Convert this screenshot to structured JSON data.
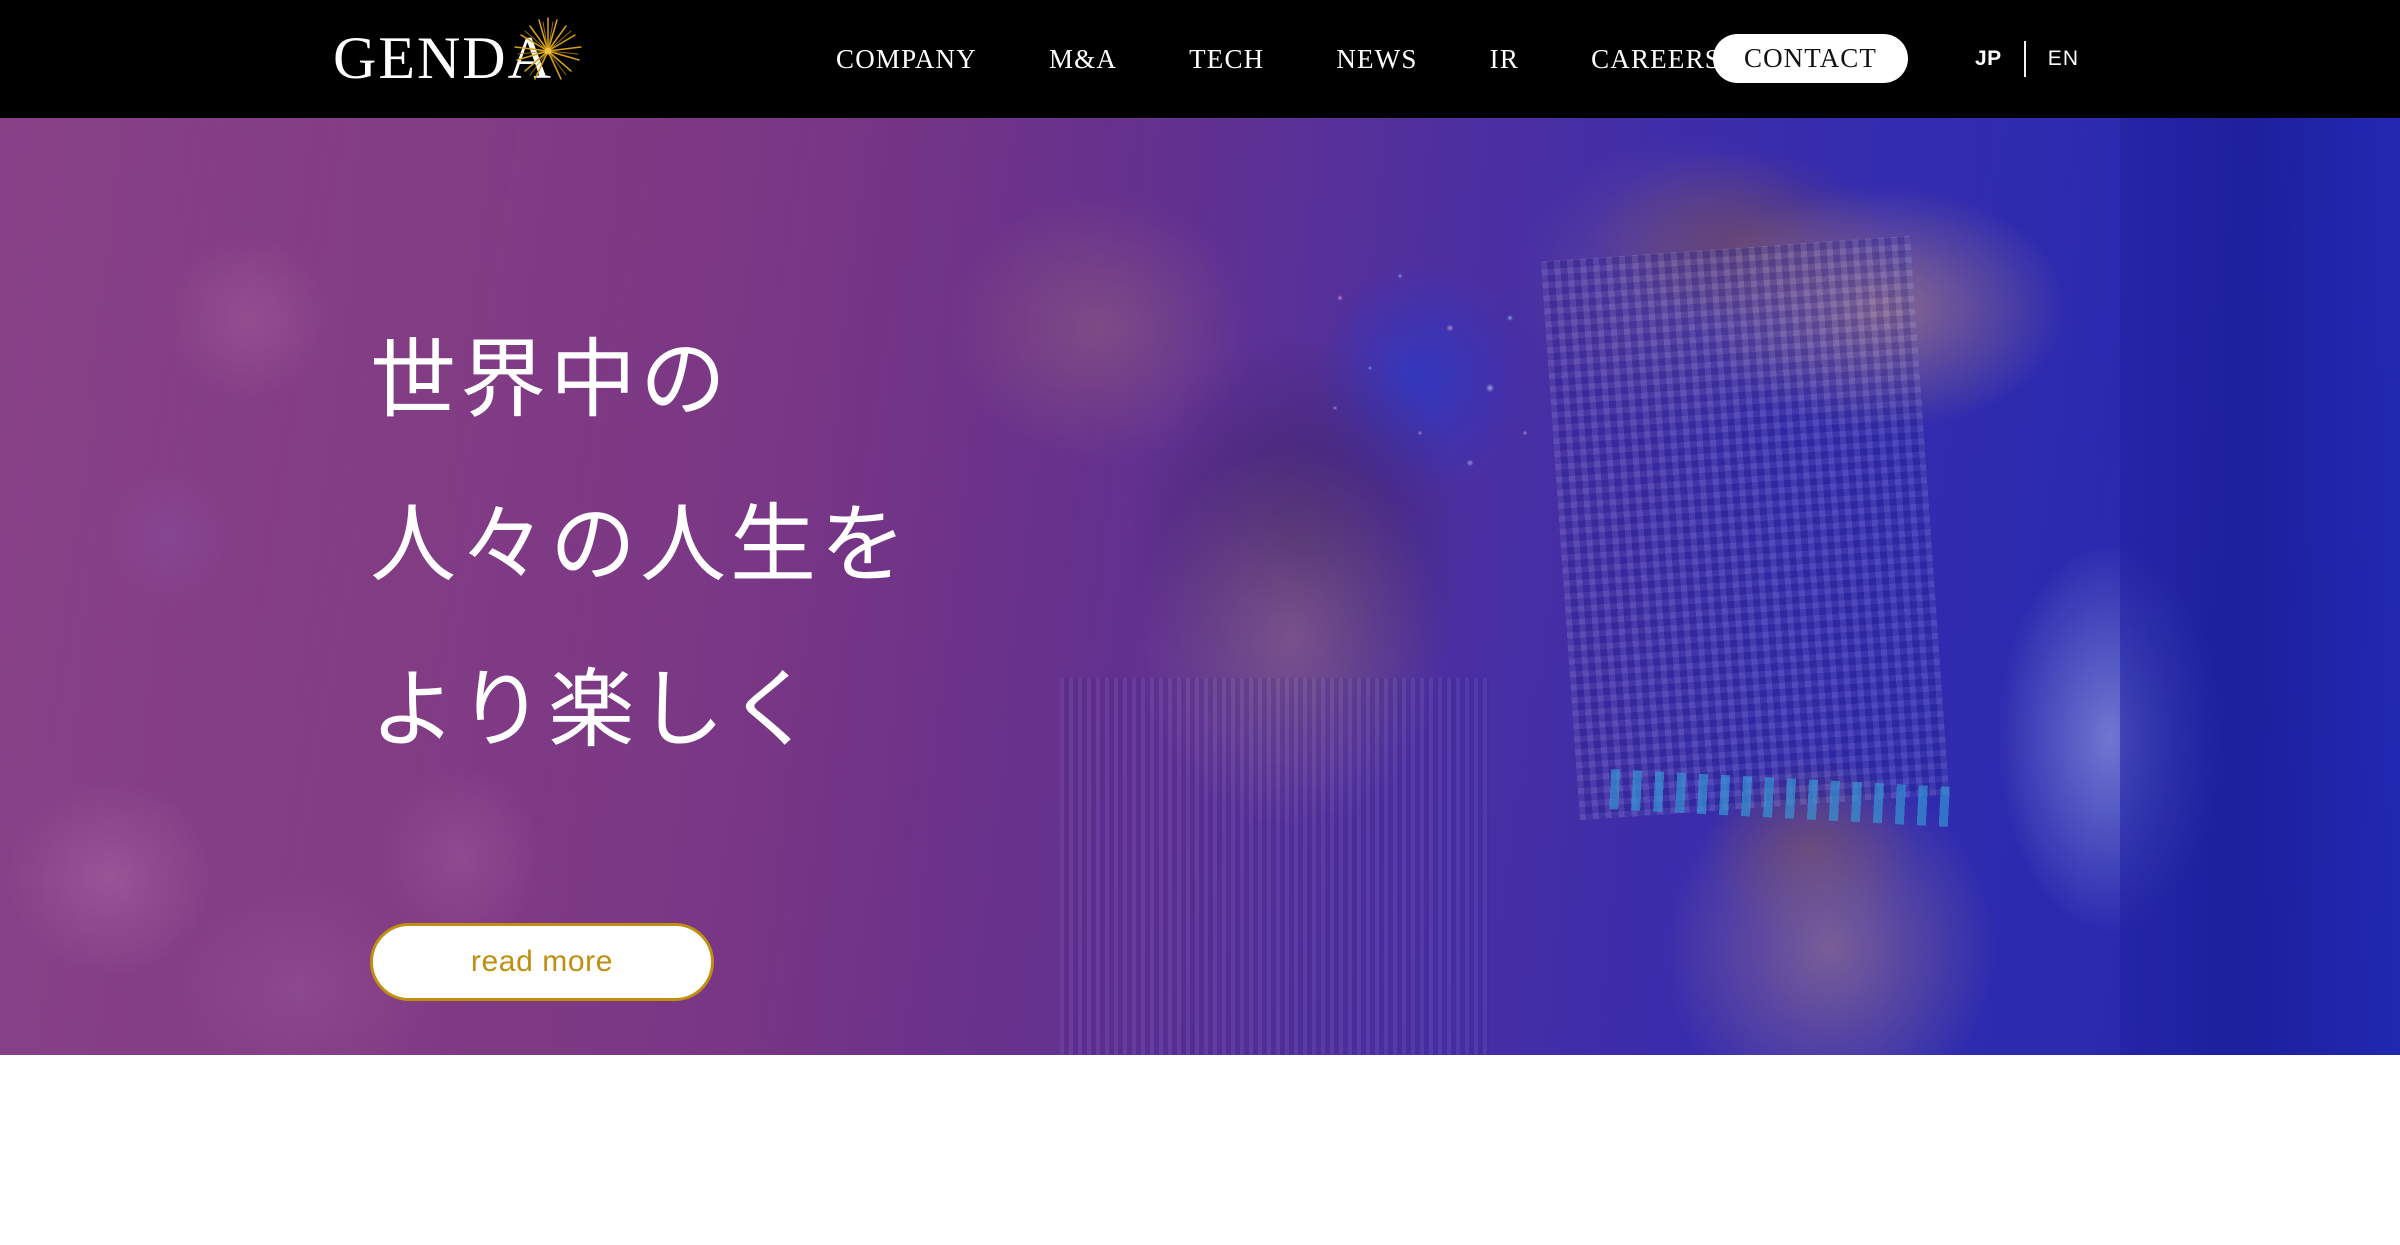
{
  "header": {
    "logo": {
      "wordmark": "GENDA",
      "spark_icon": "starburst-icon",
      "accent_color": "#d4a017"
    },
    "nav_items": [
      {
        "label": "COMPANY"
      },
      {
        "label": "M&A"
      },
      {
        "label": "TECH"
      },
      {
        "label": "NEWS"
      },
      {
        "label": "IR"
      },
      {
        "label": "CAREERS"
      }
    ],
    "contact_button": {
      "label": "CONTACT"
    },
    "language": {
      "active": "JP",
      "options": [
        {
          "code": "JP",
          "active": true
        },
        {
          "code": "EN",
          "active": false
        }
      ],
      "jp_label": "JP",
      "en_label": "EN"
    },
    "background_color": "#000000"
  },
  "hero": {
    "headline_lines": [
      "世界中の",
      "人々の人生を",
      "より楽しく"
    ],
    "cta": {
      "label": "read more"
    },
    "colors": {
      "overlay_purple": "#8c4789",
      "overlay_blue": "#2a2ea8",
      "cta_border": "#c08f10",
      "cta_text": "#c08f10",
      "cta_background": "#ffffff",
      "headline_text": "#ffffff"
    }
  },
  "below_fold": {
    "background_color": "#ffffff"
  }
}
